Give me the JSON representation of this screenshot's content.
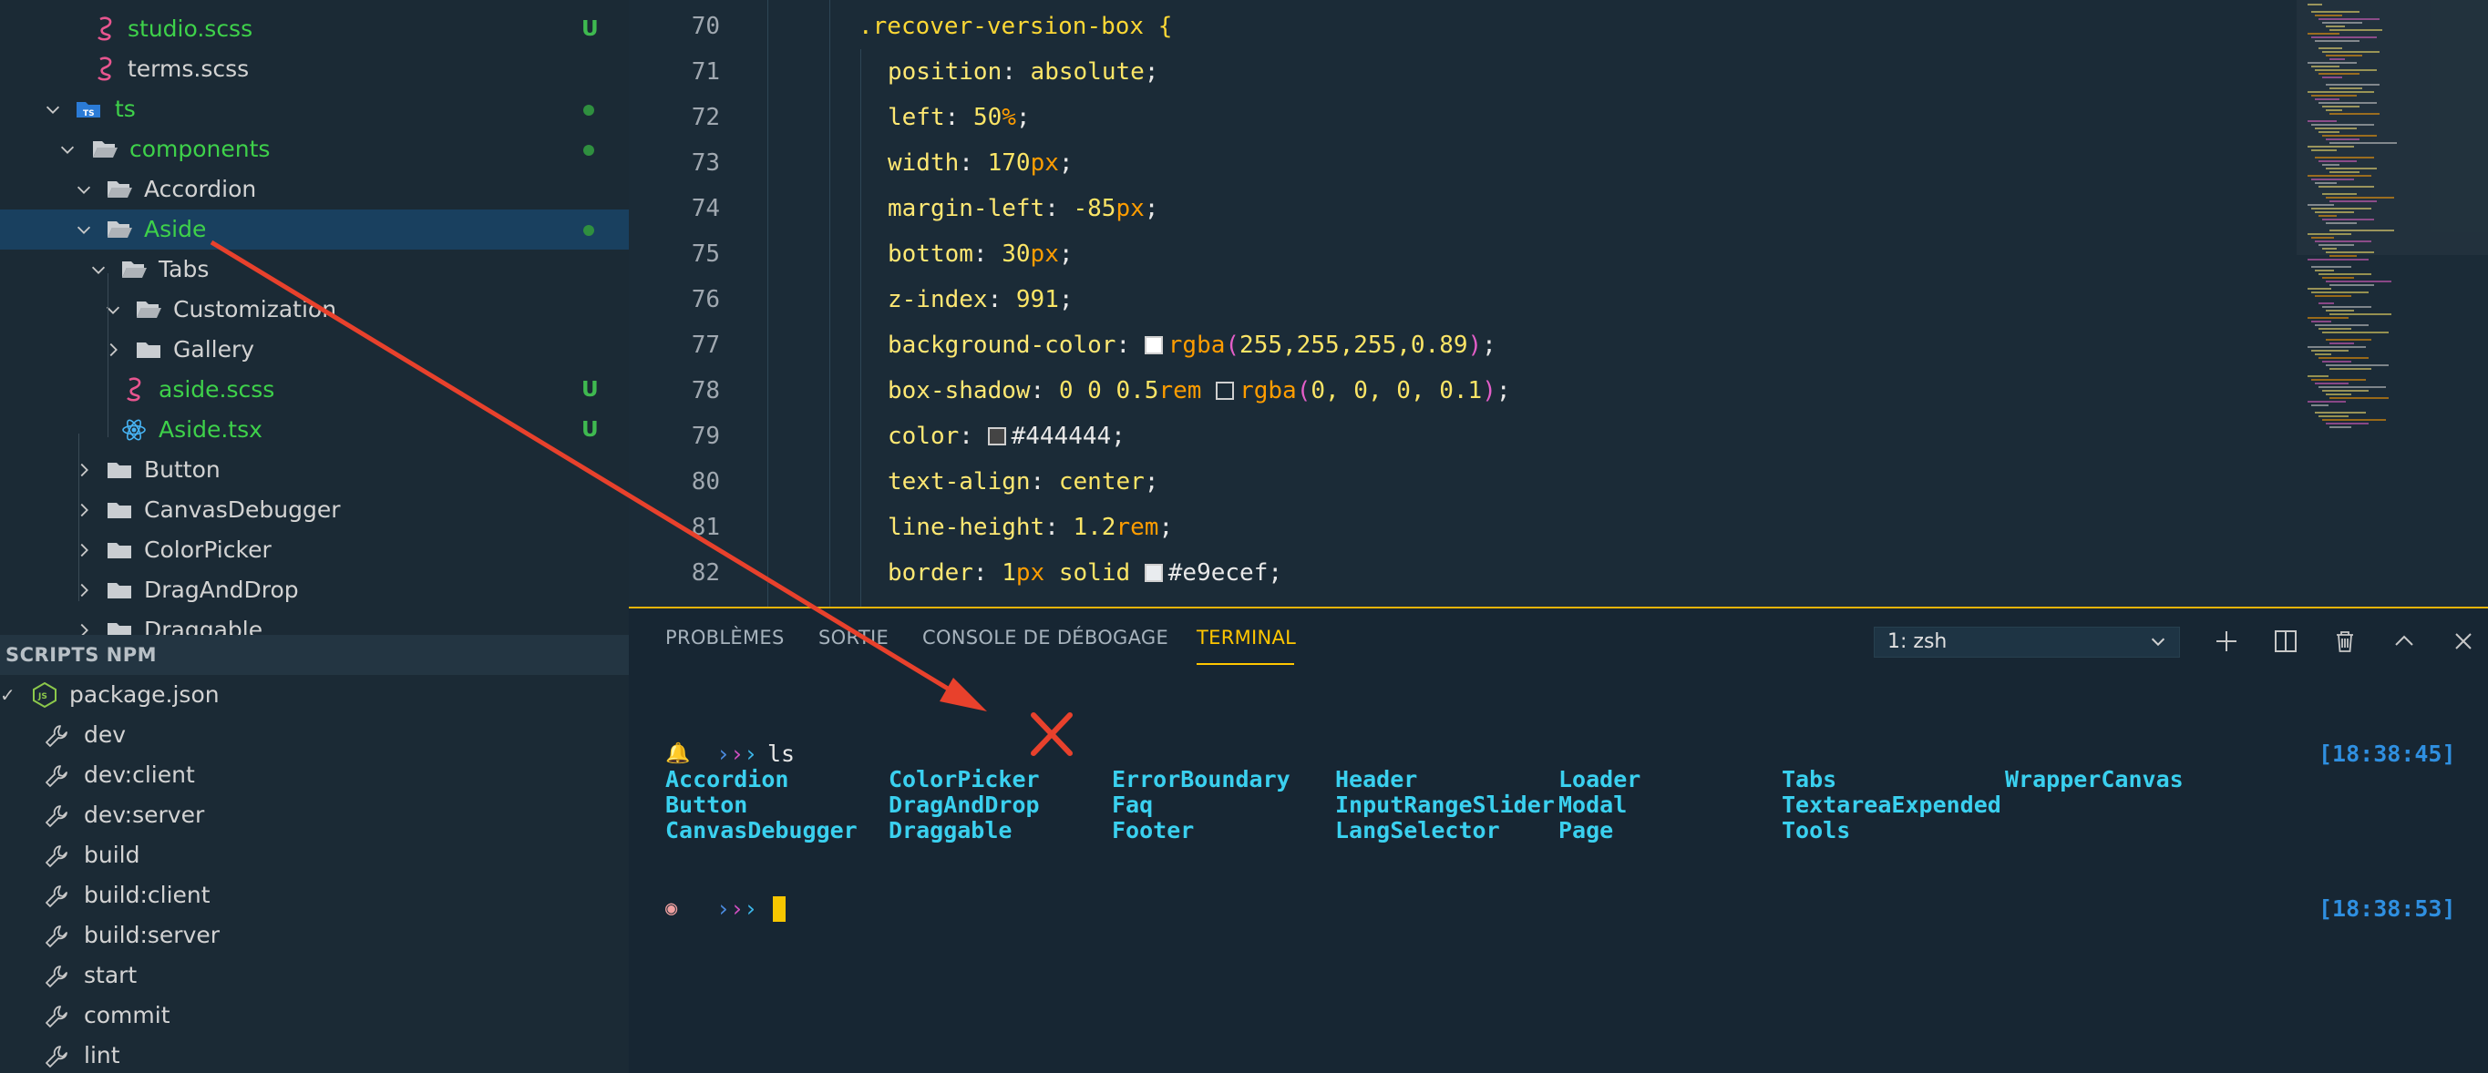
{
  "explorer": {
    "rows": [
      {
        "label": "studio.scss",
        "badge": "U"
      },
      {
        "label": "terms.scss"
      },
      {
        "label": "ts"
      },
      {
        "label": "components"
      },
      {
        "label": "Accordion"
      },
      {
        "label": "Aside"
      },
      {
        "label": "Tabs"
      },
      {
        "label": "Customization"
      },
      {
        "label": "Gallery"
      },
      {
        "label": "aside.scss",
        "badge": "U"
      },
      {
        "label": "Aside.tsx",
        "badge": "U"
      },
      {
        "label": "Button"
      },
      {
        "label": "CanvasDebugger"
      },
      {
        "label": "ColorPicker"
      },
      {
        "label": "DragAndDrop"
      },
      {
        "label": "Draggable"
      }
    ]
  },
  "npm": {
    "header": "SCRIPTS NPM",
    "package": "package.json",
    "scripts": [
      "dev",
      "dev:client",
      "dev:server",
      "build",
      "build:client",
      "build:server",
      "start",
      "commit",
      "lint"
    ]
  },
  "editor": {
    "lines": [
      {
        "n": "70",
        "t": ".recover-version-box {"
      },
      {
        "n": "71",
        "p": "position",
        "v": "absolute"
      },
      {
        "n": "72",
        "p": "left",
        "num": "50",
        "unit": "%"
      },
      {
        "n": "73",
        "p": "width",
        "num": "170",
        "unit": "px"
      },
      {
        "n": "74",
        "p": "margin-left",
        "num": "-85",
        "unit": "px"
      },
      {
        "n": "75",
        "p": "bottom",
        "num": "30",
        "unit": "px"
      },
      {
        "n": "76",
        "p": "z-index",
        "num": "991"
      },
      {
        "n": "77",
        "p": "background-color",
        "fn": "rgba",
        "args": "255,255,255,0.89",
        "swatch": "#ffffff"
      },
      {
        "n": "78",
        "p": "box-shadow",
        "pre": "0 0 0.5",
        "preunit": "rem",
        "fn": "rgba",
        "args": "0, 0, 0, 0.1",
        "swatch": "#1b2b37"
      },
      {
        "n": "79",
        "p": "color",
        "hash": "#444444",
        "swatch": "#444444"
      },
      {
        "n": "80",
        "p": "text-align",
        "v": "center"
      },
      {
        "n": "81",
        "p": "line-height",
        "num": "1.2",
        "unit": "rem"
      },
      {
        "n": "82",
        "p": "border",
        "num": "1",
        "unit": "px",
        "after": "solid",
        "hash": "#e9ecef",
        "swatch": "#e9ecef"
      }
    ]
  },
  "panel": {
    "tabs": [
      "PROBLÈMES",
      "SORTIE",
      "CONSOLE DE DÉBOGAGE",
      "TERMINAL"
    ],
    "terminal_select": "1: zsh",
    "terminal": {
      "command": "ls",
      "time1": "[18:38:45]",
      "time2": "[18:38:53]",
      "files": [
        [
          "Accordion",
          "ColorPicker",
          "ErrorBoundary",
          "Header",
          "Loader",
          "Tabs",
          "WrapperCanvas"
        ],
        [
          "Button",
          "DragAndDrop",
          "Faq",
          "InputRangeSlider",
          "Modal",
          "TextareaExpended"
        ],
        [
          "CanvasDebugger",
          "Draggable",
          "Footer",
          "LangSelector",
          "Page",
          "Tools"
        ]
      ]
    }
  },
  "colors": {
    "accent": "#ffc600",
    "annotation_red": "#e8412c",
    "git_untracked": "#3ed14a",
    "selection": "#19405f"
  }
}
